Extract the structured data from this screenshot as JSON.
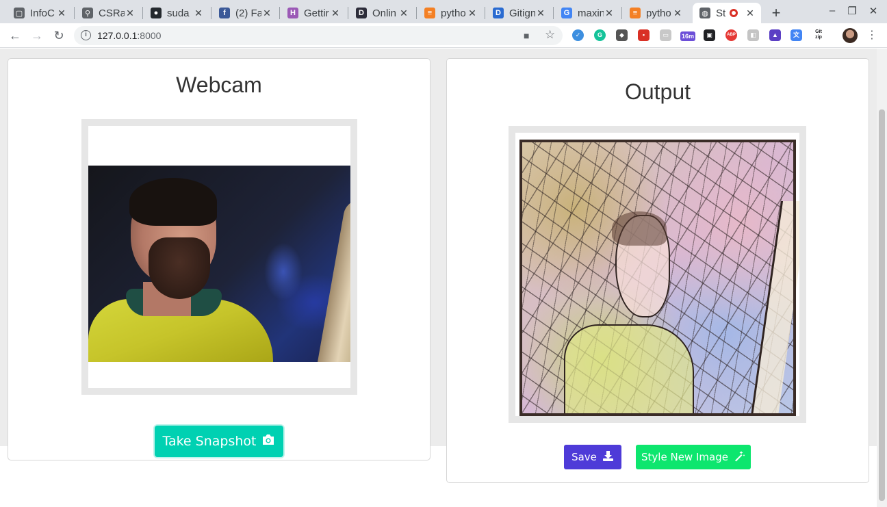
{
  "browser": {
    "tabs": [
      {
        "title": "InfoC",
        "favicon": "screenshot-icon",
        "color": "#5f6368",
        "glyph": "▢"
      },
      {
        "title": "CSRa",
        "favicon": "search-icon",
        "color": "#5f6368",
        "glyph": "⚲"
      },
      {
        "title": "suda",
        "favicon": "github-icon",
        "color": "#24292e",
        "glyph": "●"
      },
      {
        "title": "(2) Fa",
        "favicon": "facebook-icon",
        "color": "#3b5998",
        "glyph": "f"
      },
      {
        "title": "Gettir",
        "favicon": "heroku-icon",
        "color": "#9b59b6",
        "glyph": "H"
      },
      {
        "title": "Onlin",
        "favicon": "d-icon",
        "color": "#2d2d3a",
        "glyph": "D"
      },
      {
        "title": "pytho",
        "favicon": "stackoverflow-icon",
        "color": "#f48024",
        "glyph": "≡"
      },
      {
        "title": "Gitign",
        "favicon": "d-blue-icon",
        "color": "#2a6bd1",
        "glyph": "D"
      },
      {
        "title": "maxin",
        "favicon": "google-icon",
        "color": "#4285f4",
        "glyph": "G"
      },
      {
        "title": "pytho",
        "favicon": "stackoverflow-icon",
        "color": "#f48024",
        "glyph": "≡"
      },
      {
        "title": "St",
        "favicon": "globe-icon",
        "color": "#5f6368",
        "glyph": "◍"
      }
    ],
    "new_tab": "+",
    "url_host": "127.0.0.1",
    "url_port": ":8000",
    "extension_badge": "16m",
    "ext_abp": "ABP",
    "ext_gitzip": "Git zip",
    "controls": {
      "minimize": "–",
      "maximize": "❐",
      "close": "✕"
    }
  },
  "webcam_card": {
    "title": "Webcam",
    "snapshot_button": "Take Snapshot"
  },
  "output_card": {
    "title": "Output",
    "save_button": "Save",
    "style_button": "Style New Image"
  },
  "colors": {
    "snapshot": "#00d1b2",
    "save": "#4e3bd8",
    "style": "#0de66e"
  }
}
